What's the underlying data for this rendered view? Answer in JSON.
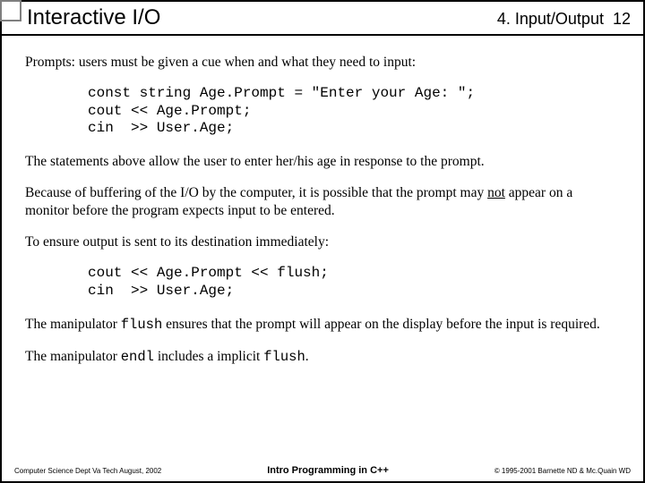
{
  "header": {
    "title": "Interactive I/O",
    "chapter": "4. Input/Output",
    "page": "12"
  },
  "body": {
    "p1": "Prompts: users must be given a cue when and what they need to input:",
    "code1": "const string Age.Prompt = \"Enter your Age: \";\ncout << Age.Prompt;\ncin  >> User.Age;",
    "p2": "The statements above allow the user to enter her/his age in response to the prompt.",
    "p3a": "Because of buffering of the I/O by the computer, it is possible that the prompt may ",
    "p3u": "not",
    "p3b": " appear on a monitor before the program expects input to be entered.",
    "p4": "To ensure output is sent to its destination immediately:",
    "code2": "cout << Age.Prompt << flush;\ncin  >> User.Age;",
    "p5a": "The manipulator ",
    "p5m": "flush",
    "p5b": " ensures that the prompt will appear on the display before the input is required.",
    "p6a": "The manipulator ",
    "p6m1": "endl",
    "p6b": " includes a implicit ",
    "p6m2": "flush",
    "p6c": "."
  },
  "footer": {
    "left": "Computer Science Dept Va Tech  August, 2002",
    "center": "Intro Programming in C++",
    "right": "© 1995-2001  Barnette ND & Mc.Quain WD"
  }
}
